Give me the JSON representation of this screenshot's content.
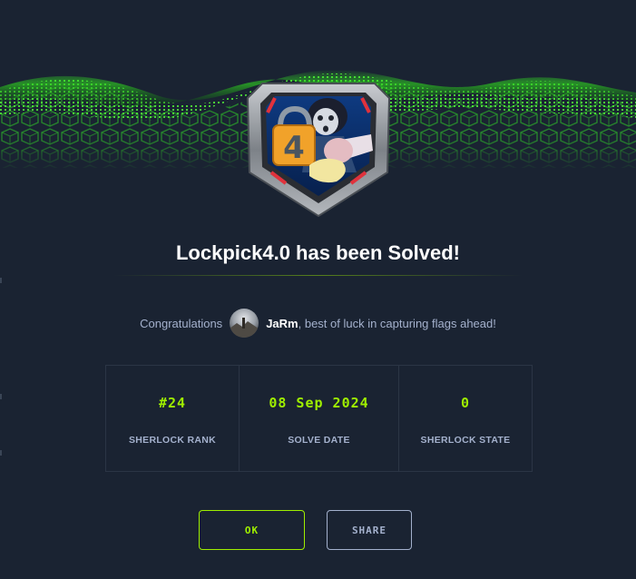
{
  "modal": {
    "title": "Lockpick4.0 has been Solved!",
    "badge_icon": "sherlock-badge-icon",
    "congrats": {
      "prefix": "Congratulations",
      "username": "JaRm",
      "suffix": ", best of luck in capturing flags ahead!"
    },
    "stats": [
      {
        "value": "#24",
        "label": "SHERLOCK RANK"
      },
      {
        "value": "08 Sep 2024",
        "label": "SOLVE DATE"
      },
      {
        "value": "0",
        "label": "SHERLOCK STATE"
      }
    ],
    "buttons": {
      "ok": "OK",
      "share": "SHARE"
    }
  },
  "colors": {
    "background": "#1a2332",
    "accent": "#9fef00",
    "muted_text": "#a4b1cd",
    "border": "#2b3545"
  }
}
